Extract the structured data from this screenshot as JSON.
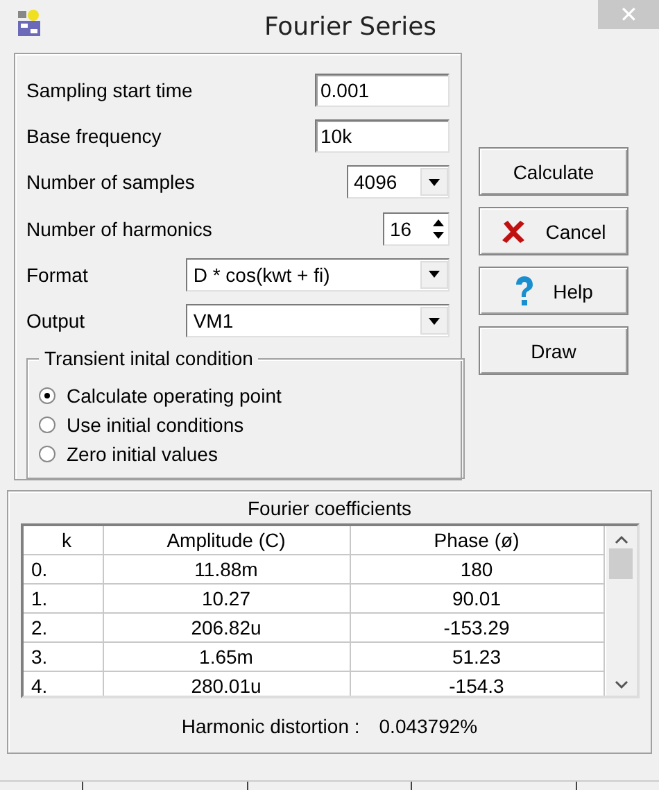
{
  "window": {
    "title": "Fourier Series",
    "close": "✕"
  },
  "fields": [
    {
      "kind": "text",
      "label": "Sampling start time",
      "value": "0.001"
    },
    {
      "kind": "text",
      "label": "Base frequency",
      "value": "10k"
    },
    {
      "kind": "combo",
      "label": "Number of samples",
      "value": "4096"
    },
    {
      "kind": "spin",
      "label": "Number of harmonics",
      "value": "16"
    },
    {
      "kind": "wide",
      "label": "Format",
      "value": "D * cos(kwt + fi)"
    },
    {
      "kind": "wide",
      "label": "Output",
      "value": "VM1"
    }
  ],
  "initial_condition": {
    "title": "Transient inital condition",
    "options": [
      {
        "label": "Calculate operating point",
        "selected": true
      },
      {
        "label": "Use initial conditions",
        "selected": false
      },
      {
        "label": "Zero initial values",
        "selected": false
      }
    ]
  },
  "buttons": [
    {
      "kind": "plain",
      "label": "Calculate"
    },
    {
      "kind": "cancel",
      "label": "Cancel"
    },
    {
      "kind": "help",
      "label": "Help"
    },
    {
      "kind": "plain",
      "label": "Draw"
    }
  ],
  "coefficients": {
    "title": "Fourier coefficients",
    "columns": [
      "k",
      "Amplitude (C)",
      "Phase (ø)"
    ],
    "rows": [
      [
        "0.",
        "11.88m",
        "180"
      ],
      [
        "1.",
        "10.27",
        "90.01"
      ],
      [
        "2.",
        "206.82u",
        "-153.29"
      ],
      [
        "3.",
        "1.65m",
        "51.23"
      ],
      [
        "4.",
        "280.01u",
        "-154.3"
      ]
    ],
    "distortion_label": "Harmonic distortion :",
    "distortion_value": "0.043792%"
  }
}
